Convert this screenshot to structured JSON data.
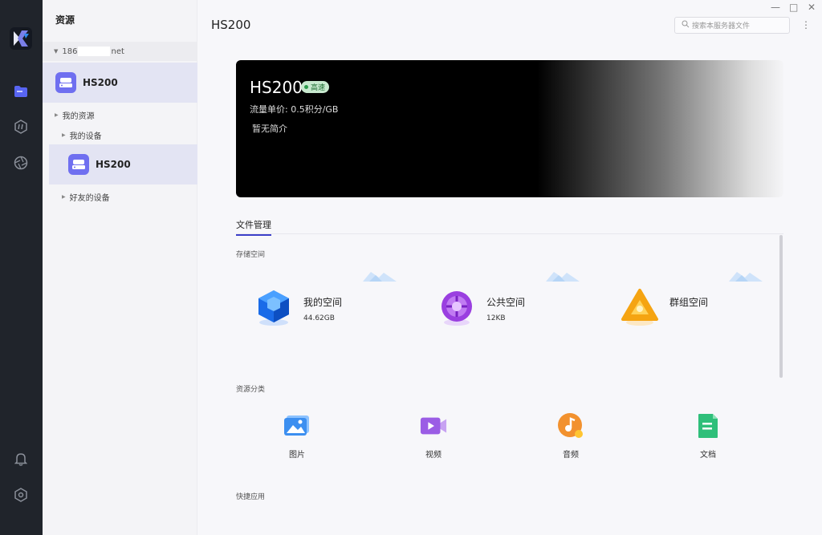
{
  "sidebar": {
    "icons": [
      "folder-icon",
      "resource-icon",
      "aperture-icon",
      "bell-icon",
      "settings-icon"
    ]
  },
  "panel": {
    "title": "资源",
    "account": {
      "prefix": "186",
      "suffix": "net"
    },
    "devices": [
      {
        "name": "HS200"
      },
      {
        "name": "HS200"
      }
    ],
    "tree": {
      "my_resources": "我的资源",
      "my_devices": "我的设备",
      "friend_devices": "好友的设备"
    }
  },
  "header": {
    "title": "HS200",
    "search_placeholder": "搜索本服务器文件",
    "window_controls": {
      "minimize": "—",
      "maximize": "□",
      "close": "✕"
    },
    "more": "⋮"
  },
  "banner": {
    "name": "HS200",
    "badge": "高速",
    "price": "流量单价: 0.5积分/GB",
    "intro": "暂无简介"
  },
  "tabs": [
    {
      "label": "文件管理",
      "active": true
    }
  ],
  "storage": {
    "section_label": "存储空间",
    "items": [
      {
        "name": "我的空间",
        "size": "44.62GB",
        "icon": "blue-cube-icon"
      },
      {
        "name": "公共空间",
        "size": "12KB",
        "icon": "purple-sphere-icon"
      },
      {
        "name": "群组空间",
        "size": "",
        "icon": "orange-triangle-icon"
      }
    ]
  },
  "categories": {
    "section_label": "资源分类",
    "items": [
      {
        "label": "图片",
        "icon": "picture-icon",
        "color": "#3c8ff0"
      },
      {
        "label": "视频",
        "icon": "video-icon",
        "color": "#9b5de5"
      },
      {
        "label": "音频",
        "icon": "audio-icon",
        "color": "#f2912e"
      },
      {
        "label": "文档",
        "icon": "document-icon",
        "color": "#2fbf7a"
      }
    ]
  },
  "quick_apps": {
    "section_label": "快捷应用"
  }
}
